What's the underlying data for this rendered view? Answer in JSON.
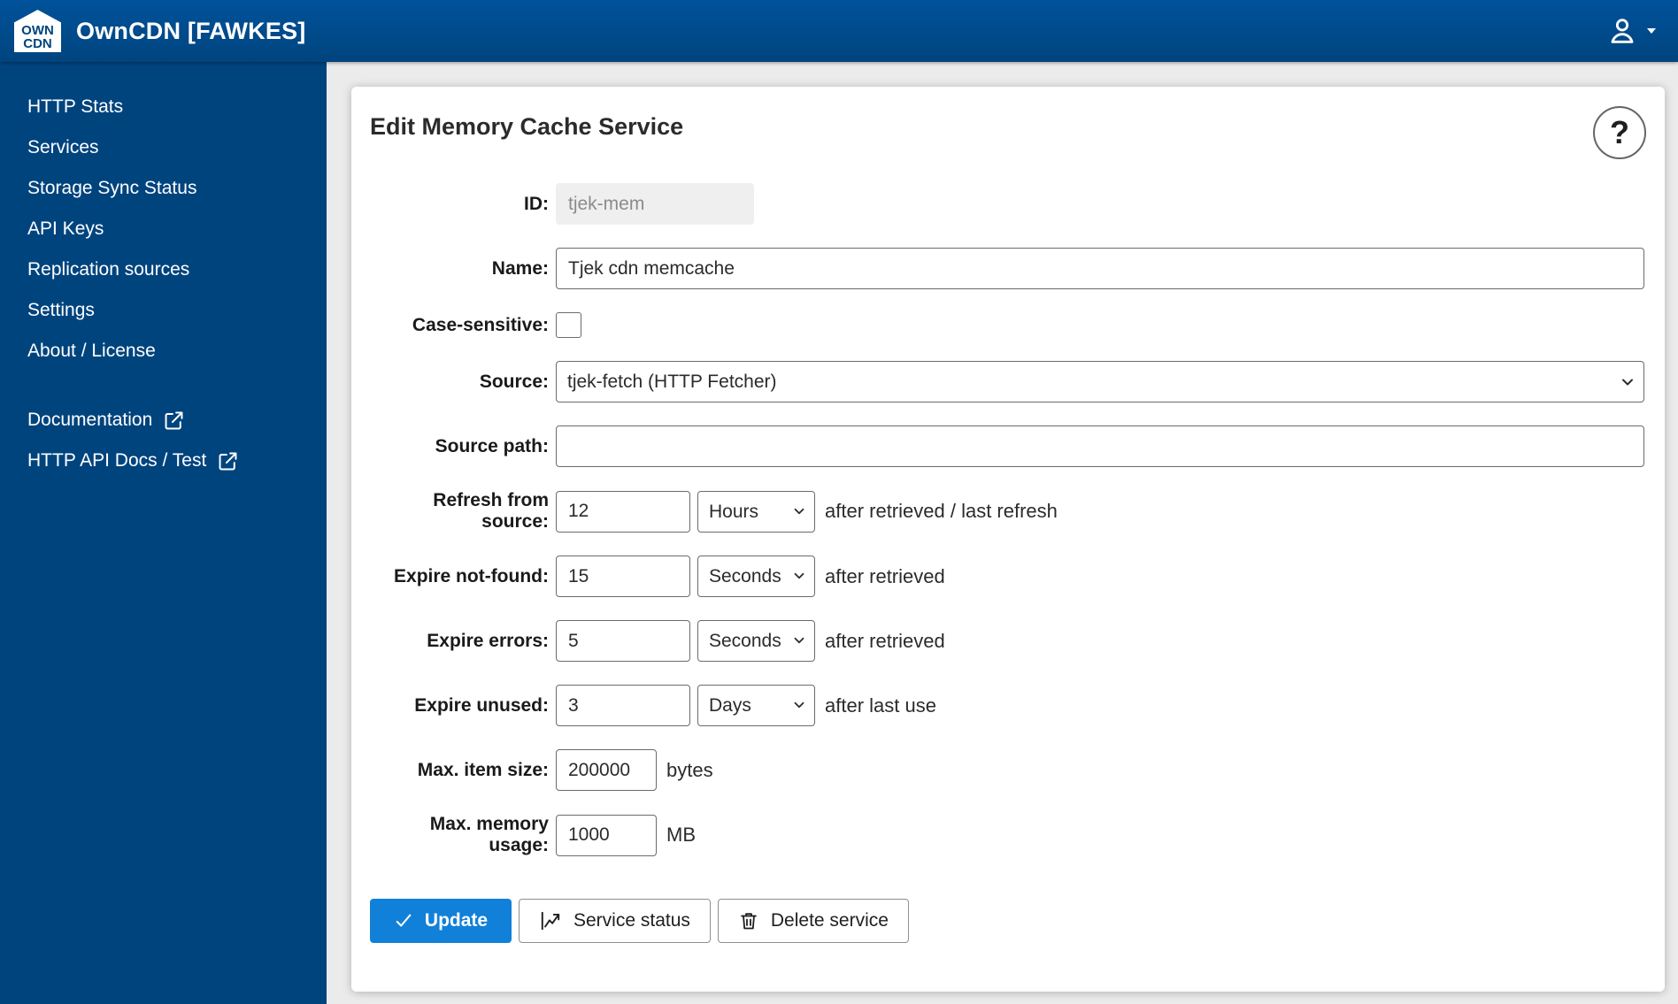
{
  "header": {
    "logo": {
      "line1": "OWN",
      "line2": "CDN"
    },
    "title": "OwnCDN [FAWKES]"
  },
  "sidebar": {
    "items": [
      {
        "label": "HTTP Stats"
      },
      {
        "label": "Services"
      },
      {
        "label": "Storage Sync Status"
      },
      {
        "label": "API Keys"
      },
      {
        "label": "Replication sources"
      },
      {
        "label": "Settings"
      },
      {
        "label": "About / License"
      }
    ],
    "external_links": [
      {
        "label": "Documentation"
      },
      {
        "label": "HTTP API Docs / Test"
      }
    ]
  },
  "main": {
    "title": "Edit Memory Cache Service",
    "help_label": "?",
    "form": {
      "id": {
        "label": "ID:",
        "value": "tjek-mem"
      },
      "name": {
        "label": "Name:",
        "value": "Tjek cdn memcache"
      },
      "case_sensitive": {
        "label": "Case-sensitive:",
        "checked": false
      },
      "source": {
        "label": "Source:",
        "selected": "tjek-fetch (HTTP Fetcher)"
      },
      "source_path": {
        "label": "Source path:",
        "value": ""
      },
      "refresh": {
        "label": "Refresh from source:",
        "value": "12",
        "unit": "Hours",
        "suffix": "after retrieved / last refresh"
      },
      "expire_not_found": {
        "label": "Expire not-found:",
        "value": "15",
        "unit": "Seconds",
        "suffix": "after retrieved"
      },
      "expire_errors": {
        "label": "Expire errors:",
        "value": "5",
        "unit": "Seconds",
        "suffix": "after retrieved"
      },
      "expire_unused": {
        "label": "Expire unused:",
        "value": "3",
        "unit": "Days",
        "suffix": "after last use"
      },
      "max_item_size": {
        "label": "Max. item size:",
        "value": "200000",
        "suffix": "bytes"
      },
      "max_memory": {
        "label": "Max. memory usage:",
        "value": "1000",
        "suffix": "MB"
      }
    },
    "buttons": {
      "update": "Update",
      "service_status": "Service status",
      "delete": "Delete service"
    }
  },
  "colors": {
    "brand_blue": "#00447e",
    "header_gradient_top": "#00529b",
    "accent_blue": "#1180d8",
    "page_bg": "#ebebeb",
    "disabled_bg": "#efefef"
  }
}
